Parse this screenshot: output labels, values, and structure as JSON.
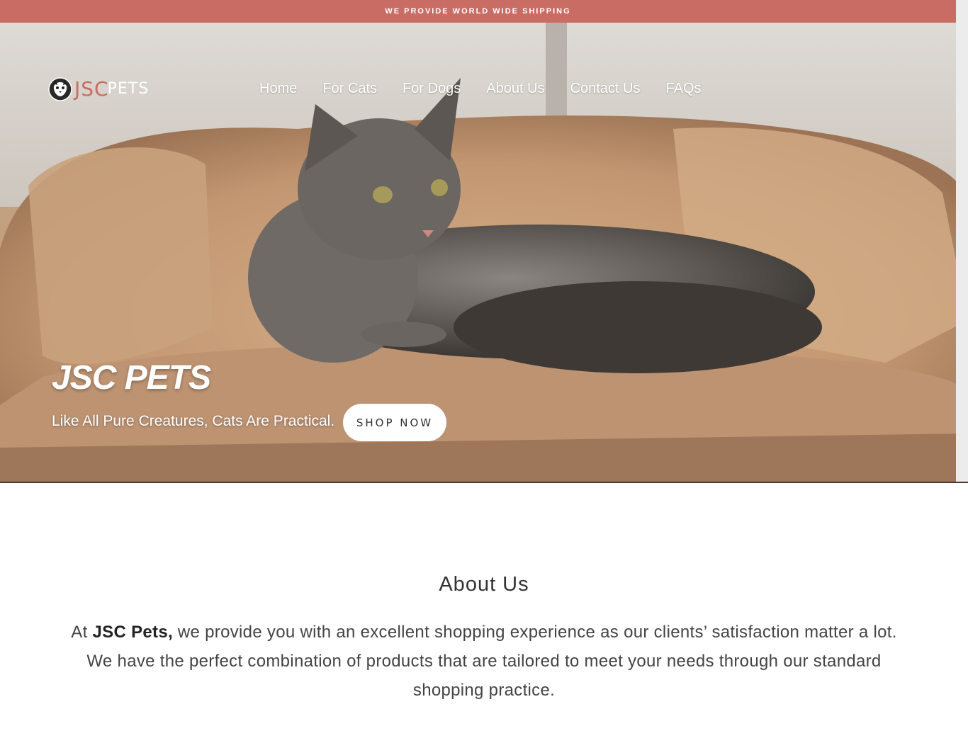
{
  "topbar": {
    "text": "WE PROVIDE WORLD WIDE SHIPPING"
  },
  "logo": {
    "jsc": "JSC",
    "pets": "PETS"
  },
  "nav": {
    "items": [
      {
        "label": "Home"
      },
      {
        "label": "For Cats"
      },
      {
        "label": "For Dogs"
      },
      {
        "label": "About Us"
      },
      {
        "label": "Contact Us"
      },
      {
        "label": "FAQs"
      }
    ]
  },
  "hero": {
    "title": "JSC PETS",
    "subtitle": "Like All Pure Creatures, Cats Are Practical.",
    "cta": "SHOP NOW"
  },
  "about": {
    "title": "About Us",
    "lead": "At ",
    "brand": "JSC Pets,",
    "body": " we provide you with an excellent shopping experience as our clients’ satisfaction matter a lot. We have the perfect combination of products that are tailored to meet your needs through our standard shopping practice."
  },
  "colors": {
    "accent": "#c96c64",
    "hero_bg": "#c49d78"
  }
}
